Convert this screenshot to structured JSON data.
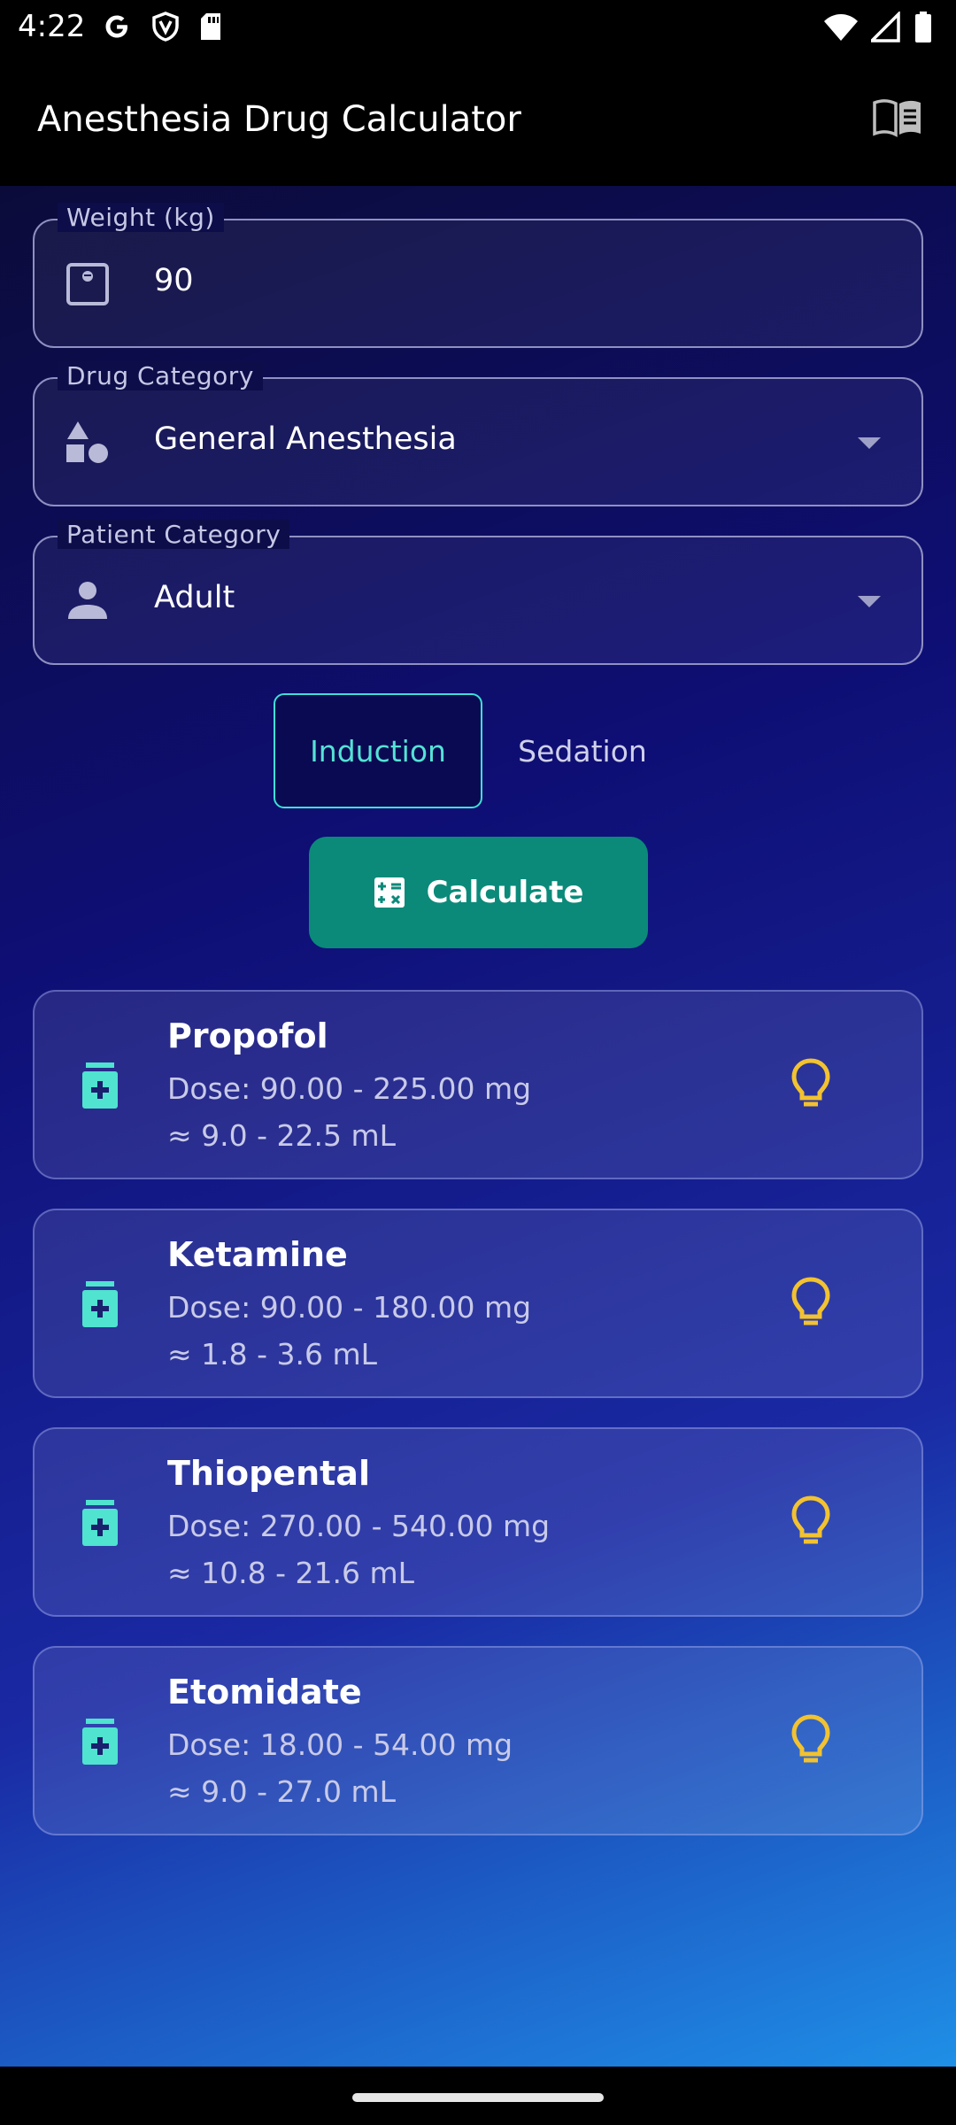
{
  "status_bar": {
    "time": "4:22",
    "left_icons": [
      "google-icon",
      "shield-icon",
      "sd-card-icon"
    ],
    "right_icons": [
      "wifi-icon",
      "signal-icon",
      "battery-icon"
    ]
  },
  "app_bar": {
    "title": "Anesthesia Drug Calculator",
    "action_icon": "book-icon"
  },
  "form": {
    "weight": {
      "label": "Weight (kg)",
      "value": "90",
      "icon": "scale-icon"
    },
    "drug_category": {
      "label": "Drug Category",
      "value": "General Anesthesia",
      "icon": "category-icon"
    },
    "patient_category": {
      "label": "Patient Category",
      "value": "Adult",
      "icon": "person-icon"
    }
  },
  "segments": {
    "options": [
      "Induction",
      "Sedation"
    ],
    "selected": "Induction"
  },
  "calculate_button": {
    "label": "Calculate",
    "icon": "calculate-icon"
  },
  "results": [
    {
      "name": "Propofol",
      "dose": "Dose: 90.00 - 225.00 mg",
      "volume": "≈ 9.0 - 22.5 mL"
    },
    {
      "name": "Ketamine",
      "dose": "Dose: 90.00 - 180.00 mg",
      "volume": "≈ 1.8 - 3.6 mL"
    },
    {
      "name": "Thiopental",
      "dose": "Dose: 270.00 - 540.00 mg",
      "volume": "≈ 10.8 - 21.6 mL"
    },
    {
      "name": "Etomidate",
      "dose": "Dose: 18.00 - 54.00 mg",
      "volume": "≈ 9.0 - 27.0 mL"
    }
  ],
  "colors": {
    "accent_teal": "#0b8a7a",
    "selected_outline": "#3de0d6",
    "medication_icon": "#4fe3d0",
    "bulb_icon": "#f2c230"
  }
}
